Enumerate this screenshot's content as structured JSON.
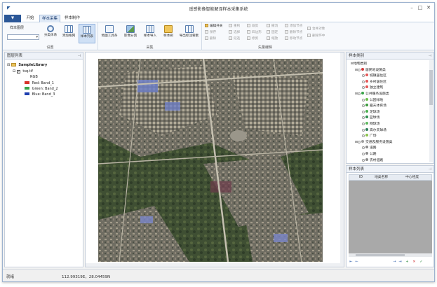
{
  "window": {
    "title": "遥感影像智能解译样本采集系统"
  },
  "tabs": [
    {
      "label": "▼"
    },
    {
      "label": "开始"
    },
    {
      "label": "样本采集"
    },
    {
      "label": "样本制作"
    }
  ],
  "ribbon": {
    "settings": {
      "label": "设置",
      "sample_layer_label": "样本图层",
      "sample_layer_value": "",
      "buttons": [
        "分类体系",
        "添加格网",
        "样本列表"
      ]
    },
    "collect": {
      "label": "采集",
      "buttons": [
        "地图工具条",
        "影像分割",
        "样本导入",
        "样本刷",
        "导出标注要素"
      ]
    },
    "vector": {
      "label": "矢量编辑",
      "col1": [
        "编辑开关",
        "保存",
        "删除"
      ],
      "col2": [
        "重构",
        "选择",
        "延选"
      ],
      "col3": [
        "裁剪",
        "四边形",
        "修剪"
      ],
      "col4": [
        "撤消",
        "固定",
        "缩放"
      ],
      "col5": [
        "添加节点",
        "删除节点",
        "移动节点"
      ],
      "col6": [
        "合并对象",
        "删除环中"
      ]
    }
  },
  "layer_panel": {
    "title": "图层列表",
    "library": "SampleLibrary",
    "layer": "tsq.tif",
    "mode": "RGB",
    "bands": [
      {
        "channel": "Red:",
        "band": "Band_1",
        "color": "#d9342b"
      },
      {
        "channel": "Green:",
        "band": "Band_2",
        "color": "#3aa54a"
      },
      {
        "channel": "Blue:",
        "band": "Band_3",
        "color": "#1f3fb0"
      }
    ]
  },
  "category_panel": {
    "title": "样本类别",
    "items": [
      {
        "label": "地物类别",
        "level": 0,
        "color": ""
      },
      {
        "label": "居民地设施类",
        "level": 1,
        "color": "#d23a3a"
      },
      {
        "label": "城镇居住区",
        "level": 2,
        "color": "#e45757"
      },
      {
        "label": "乡村居住区",
        "level": 2,
        "color": "#e45757"
      },
      {
        "label": "独立建筑",
        "level": 2,
        "color": "#e45757"
      },
      {
        "label": "公共服务设施类",
        "level": 1,
        "color": "#39a34a"
      },
      {
        "label": "公园绿地",
        "level": 2,
        "color": "#6bbf4a"
      },
      {
        "label": "露天体育场",
        "level": 2,
        "color": "#3b9a3c"
      },
      {
        "label": "足球场",
        "level": 2,
        "color": "#4caf50"
      },
      {
        "label": "篮球场",
        "level": 2,
        "color": "#2f8f4f"
      },
      {
        "label": "网球场",
        "level": 2,
        "color": "#5cb85c"
      },
      {
        "label": "高尔夫球场",
        "level": 2,
        "color": "#2e7d5a"
      },
      {
        "label": "广场",
        "level": 2,
        "color": "#8bc34a"
      },
      {
        "label": "交通及服务设施类",
        "level": 1,
        "color": "#9e9e9e"
      },
      {
        "label": "道路",
        "level": 2,
        "color": "#8a8a8a"
      },
      {
        "label": "公路",
        "level": 2,
        "color": "#8a8a8a"
      },
      {
        "label": "农村道路",
        "level": 2,
        "color": "#8a8a8a"
      }
    ]
  },
  "sample_list": {
    "title": "样本列表",
    "columns": [
      "ID",
      "地类名称",
      "中心经度"
    ],
    "nav": [
      "⇤",
      "←",
      "→",
      "⇥",
      "+",
      "✕",
      "✓"
    ]
  },
  "status": {
    "state": "就绪",
    "coords": "112.99319E，28.04459N"
  },
  "colors": {
    "accent": "#2b5797",
    "panel_border": "#c6cfdb"
  }
}
